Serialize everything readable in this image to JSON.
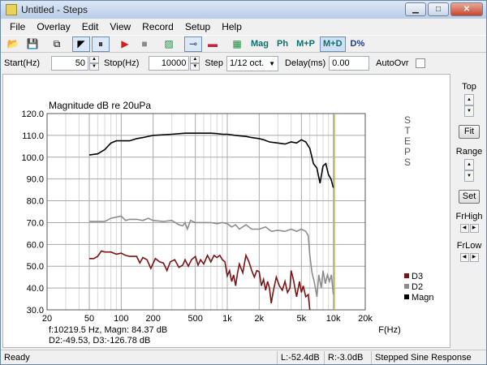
{
  "window": {
    "title": "Untitled - Steps",
    "minimize": "▁",
    "maximize": "□",
    "close": "✕"
  },
  "menu": [
    "File",
    "Overlay",
    "Edit",
    "View",
    "Record",
    "Setup",
    "Help"
  ],
  "toolbar": {
    "buttons": [
      {
        "name": "open-folder-icon",
        "glyph": "📂",
        "pressed": false
      },
      {
        "name": "save-icon",
        "glyph": "💾",
        "pressed": false
      },
      {
        "name": "copy-icon",
        "glyph": "⧉",
        "pressed": false
      },
      {
        "name": "marker-icon",
        "glyph": "◤",
        "pressed": true
      },
      {
        "name": "pause-icon",
        "glyph": "⏸",
        "pressed": true
      },
      {
        "name": "record-start-icon",
        "glyph": "▶",
        "pressed": false,
        "color": "#d81c1c"
      },
      {
        "name": "stop-icon",
        "glyph": "■",
        "pressed": false,
        "color": "#8a8a8a"
      },
      {
        "name": "generator-icon",
        "glyph": "▨",
        "pressed": false,
        "color": "#1b8a3a"
      },
      {
        "name": "probe-icon",
        "glyph": "⊸",
        "pressed": true,
        "color": "#1f3f9a"
      },
      {
        "name": "flag-icon",
        "glyph": "▬",
        "pressed": false,
        "color": "#c0263a"
      },
      {
        "name": "scope-icon",
        "glyph": "▦",
        "pressed": false,
        "color": "#1b8a3a"
      }
    ],
    "views": [
      {
        "label": "Mag",
        "pressed": false
      },
      {
        "label": "Ph",
        "pressed": false
      },
      {
        "label": "M+P",
        "pressed": false
      },
      {
        "label": "M+D",
        "pressed": true
      },
      {
        "label": "D%",
        "pressed": false
      }
    ]
  },
  "params": {
    "start_label": "Start(Hz)",
    "start_value": "50",
    "stop_label": "Stop(Hz)",
    "stop_value": "10000",
    "step_label": "Step",
    "step_value": "1/12 oct.",
    "delay_label": "Delay(ms)",
    "delay_value": "0.00",
    "autoovr_label": "AutoOvr"
  },
  "side": {
    "top_label": "Top",
    "fit_label": "Fit",
    "range_label": "Range",
    "set_label": "Set",
    "frhigh_label": "FrHigh",
    "frlow_label": "FrLow"
  },
  "status": {
    "ready": "Ready",
    "left": "L:-52.4dB",
    "right": "R:-3.0dB",
    "mode": "Stepped Sine Response"
  },
  "chart_data": {
    "type": "line",
    "title": "Magnitude dB re 20uPa",
    "side_caption": "STEPS",
    "xlabel": "F(Hz)",
    "xscale": "log",
    "xlim": [
      20,
      20000
    ],
    "ylim": [
      30,
      120
    ],
    "xticks": [
      {
        "v": 20,
        "label": "20"
      },
      {
        "v": 50,
        "label": "50"
      },
      {
        "v": 100,
        "label": "100"
      },
      {
        "v": 200,
        "label": "200"
      },
      {
        "v": 500,
        "label": "500"
      },
      {
        "v": 1000,
        "label": "1k"
      },
      {
        "v": 2000,
        "label": "2k"
      },
      {
        "v": 5000,
        "label": "5k"
      },
      {
        "v": 10000,
        "label": "10k"
      },
      {
        "v": 20000,
        "label": "20k"
      }
    ],
    "yticks": [
      {
        "v": 30,
        "label": "30.0"
      },
      {
        "v": 40,
        "label": "40.0"
      },
      {
        "v": 50,
        "label": "50.0"
      },
      {
        "v": 60,
        "label": "60.0"
      },
      {
        "v": 70,
        "label": "70.0"
      },
      {
        "v": 80,
        "label": "80.0"
      },
      {
        "v": 90,
        "label": "90.0"
      },
      {
        "v": 100,
        "label": "100.0"
      },
      {
        "v": 110,
        "label": "110.0"
      },
      {
        "v": 120,
        "label": "120.0"
      }
    ],
    "cursor_x": 10219.5,
    "readout_line1": "f:10219.5 Hz, Magn: 84.37 dB",
    "readout_line2": "D2:-49.53, D3:-126.78 dB",
    "legend_position": "bottom-right",
    "series": [
      {
        "name": "Magn",
        "color": "#000000",
        "points": [
          [
            50,
            101
          ],
          [
            60,
            101.5
          ],
          [
            70,
            103.5
          ],
          [
            80,
            106.5
          ],
          [
            90,
            107.5
          ],
          [
            100,
            107.5
          ],
          [
            120,
            107.5
          ],
          [
            140,
            108.5
          ],
          [
            160,
            109
          ],
          [
            200,
            110
          ],
          [
            300,
            110.5
          ],
          [
            400,
            111
          ],
          [
            500,
            111
          ],
          [
            600,
            111
          ],
          [
            700,
            111
          ],
          [
            800,
            110.8
          ],
          [
            900,
            110.5
          ],
          [
            1000,
            110.5
          ],
          [
            1200,
            110
          ],
          [
            1500,
            109.5
          ],
          [
            1700,
            109
          ],
          [
            2000,
            108.5
          ],
          [
            2200,
            108
          ],
          [
            2500,
            107
          ],
          [
            3000,
            106.5
          ],
          [
            3500,
            106
          ],
          [
            4000,
            107
          ],
          [
            4500,
            106.5
          ],
          [
            5000,
            108
          ],
          [
            5500,
            107
          ],
          [
            6000,
            104
          ],
          [
            6500,
            97
          ],
          [
            7000,
            95
          ],
          [
            7500,
            88
          ],
          [
            8000,
            96
          ],
          [
            8500,
            97
          ],
          [
            9000,
            92
          ],
          [
            9500,
            90
          ],
          [
            10000,
            86
          ]
        ]
      },
      {
        "name": "D2",
        "color": "#8c8c8c",
        "points": [
          [
            50,
            70.5
          ],
          [
            60,
            70.5
          ],
          [
            70,
            70.5
          ],
          [
            80,
            72
          ],
          [
            90,
            72.5
          ],
          [
            100,
            73
          ],
          [
            110,
            71
          ],
          [
            120,
            71.5
          ],
          [
            140,
            71.5
          ],
          [
            160,
            71
          ],
          [
            180,
            72
          ],
          [
            200,
            71
          ],
          [
            250,
            70.5
          ],
          [
            300,
            71
          ],
          [
            350,
            69
          ],
          [
            380,
            68.5
          ],
          [
            400,
            70
          ],
          [
            420,
            67
          ],
          [
            450,
            71
          ],
          [
            500,
            70
          ],
          [
            600,
            70
          ],
          [
            700,
            70
          ],
          [
            800,
            69.5
          ],
          [
            900,
            70
          ],
          [
            1000,
            69.5
          ],
          [
            1100,
            68
          ],
          [
            1200,
            69
          ],
          [
            1300,
            67
          ],
          [
            1500,
            69
          ],
          [
            1700,
            67
          ],
          [
            2000,
            67
          ],
          [
            2300,
            68
          ],
          [
            2600,
            66
          ],
          [
            3000,
            66.5
          ],
          [
            3500,
            66
          ],
          [
            4000,
            67
          ],
          [
            4500,
            66
          ],
          [
            5000,
            67
          ],
          [
            5500,
            66
          ],
          [
            5800,
            64
          ],
          [
            6000,
            55
          ],
          [
            6300,
            47
          ],
          [
            6600,
            43
          ],
          [
            7000,
            36
          ],
          [
            7300,
            46
          ],
          [
            7700,
            40
          ],
          [
            8000,
            48
          ],
          [
            8400,
            42
          ],
          [
            8800,
            46
          ],
          [
            9200,
            43
          ],
          [
            9600,
            46
          ],
          [
            10000,
            37
          ]
        ]
      },
      {
        "name": "D3",
        "color": "#7a1414",
        "points": [
          [
            50,
            53.5
          ],
          [
            55,
            53.5
          ],
          [
            60,
            54.5
          ],
          [
            65,
            57
          ],
          [
            70,
            56.5
          ],
          [
            80,
            56.5
          ],
          [
            90,
            55.5
          ],
          [
            100,
            56
          ],
          [
            110,
            55
          ],
          [
            120,
            54.5
          ],
          [
            140,
            54.5
          ],
          [
            150,
            51.5
          ],
          [
            160,
            54
          ],
          [
            175,
            53
          ],
          [
            190,
            49
          ],
          [
            210,
            53.5
          ],
          [
            230,
            52
          ],
          [
            250,
            51.5
          ],
          [
            270,
            48
          ],
          [
            290,
            52
          ],
          [
            320,
            53
          ],
          [
            350,
            49.5
          ],
          [
            380,
            50.5
          ],
          [
            400,
            53
          ],
          [
            430,
            50
          ],
          [
            460,
            53
          ],
          [
            500,
            54.5
          ],
          [
            530,
            50.5
          ],
          [
            560,
            53
          ],
          [
            600,
            51
          ],
          [
            650,
            55
          ],
          [
            700,
            52
          ],
          [
            750,
            55
          ],
          [
            800,
            54
          ],
          [
            850,
            55
          ],
          [
            900,
            53
          ],
          [
            950,
            52
          ],
          [
            1000,
            45.5
          ],
          [
            1050,
            48
          ],
          [
            1100,
            43
          ],
          [
            1150,
            46
          ],
          [
            1200,
            41
          ],
          [
            1250,
            47
          ],
          [
            1300,
            51
          ],
          [
            1400,
            47
          ],
          [
            1500,
            55
          ],
          [
            1600,
            52
          ],
          [
            1700,
            48
          ],
          [
            1800,
            45
          ],
          [
            1900,
            48
          ],
          [
            2000,
            47.5
          ],
          [
            2100,
            41
          ],
          [
            2200,
            44
          ],
          [
            2300,
            39
          ],
          [
            2400,
            43
          ],
          [
            2500,
            40
          ],
          [
            2600,
            33
          ],
          [
            2700,
            38
          ],
          [
            2900,
            45
          ],
          [
            3100,
            41
          ],
          [
            3300,
            39
          ],
          [
            3500,
            43
          ],
          [
            3700,
            38
          ],
          [
            3900,
            40
          ],
          [
            4000,
            48
          ],
          [
            4200,
            44
          ],
          [
            4500,
            36
          ],
          [
            4800,
            43
          ],
          [
            5000,
            38
          ],
          [
            5200,
            41
          ],
          [
            5500,
            36
          ],
          [
            5800,
            37
          ],
          [
            6000,
            30
          ]
        ]
      }
    ]
  }
}
